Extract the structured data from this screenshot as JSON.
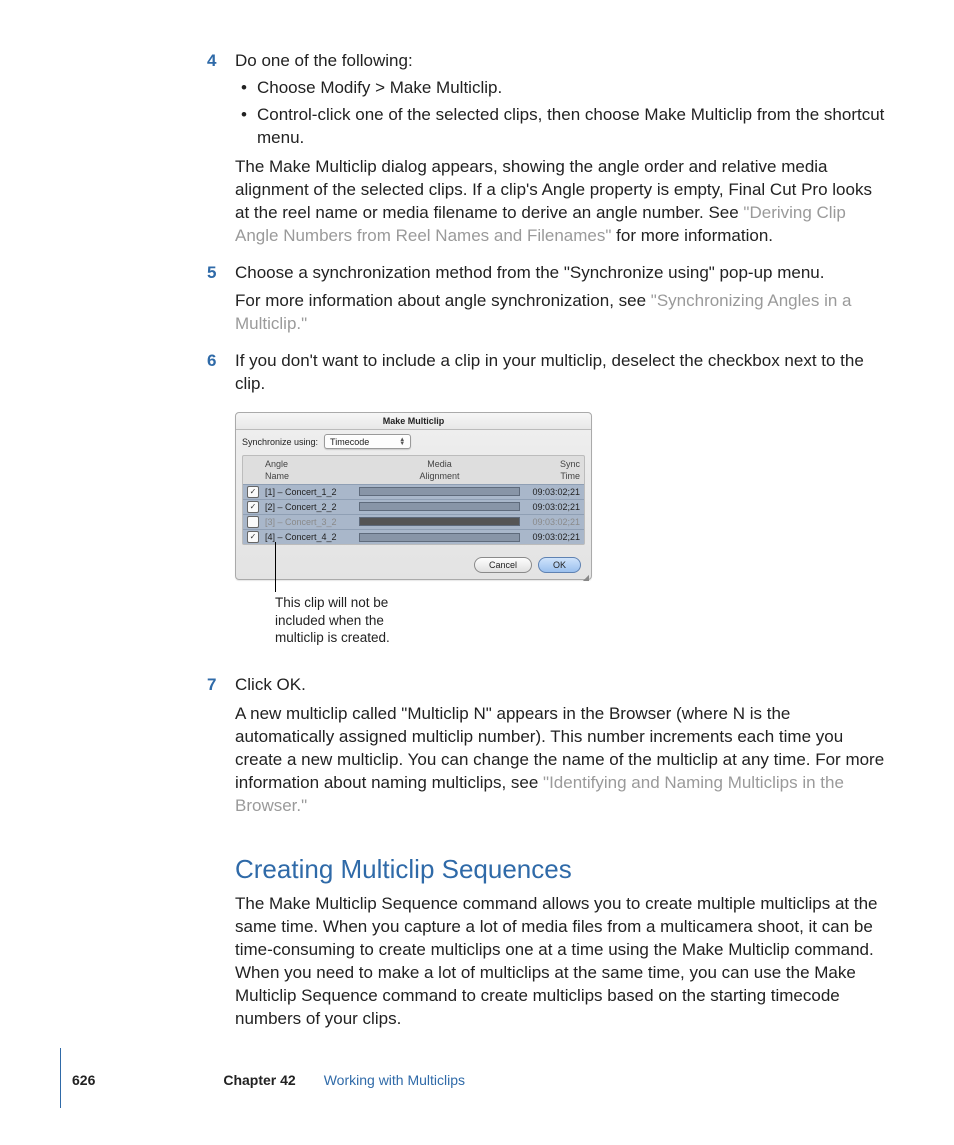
{
  "steps": {
    "s4": {
      "num": "4",
      "text": "Do one of the following:",
      "bullets": [
        "Choose Modify > Make Multiclip.",
        "Control-click one of the selected clips, then choose Make Multiclip from the shortcut menu."
      ],
      "para_pre": "The Make Multiclip dialog appears, showing the angle order and relative media alignment of the selected clips. If a clip's Angle property is empty, Final Cut Pro looks at the reel name or media filename to derive an angle number. See ",
      "para_link": "\"Deriving Clip Angle Numbers from Reel Names and Filenames\"",
      "para_post": " for more information."
    },
    "s5": {
      "num": "5",
      "text": "Choose a synchronization method from the \"Synchronize using\" pop-up menu.",
      "para_pre": "For more information about angle synchronization, see ",
      "para_link": "\"Synchronizing Angles in a Multiclip.\""
    },
    "s6": {
      "num": "6",
      "text": "If you don't want to include a clip in your multiclip, deselect the checkbox next to the clip."
    },
    "s7": {
      "num": "7",
      "text": "Click OK.",
      "para_pre": "A new multiclip called \"Multiclip N\" appears in the Browser (where N is the automatically assigned multiclip number). This number increments each time you create a new multiclip. You can change the name of the multiclip at any time. For more information about naming multiclips, see ",
      "para_link": "\"Identifying and Naming Multiclips in the Browser.\""
    }
  },
  "dialog": {
    "title": "Make Multiclip",
    "sync_label": "Synchronize using:",
    "sync_value": "Timecode",
    "headers": {
      "angle": "Angle\nName",
      "media": "Media\nAlignment",
      "sync": "Sync\nTime"
    },
    "rows": [
      {
        "checked": true,
        "angle": "[1] – Concert_1_2",
        "sync": "09:03:02;21",
        "disabled": false
      },
      {
        "checked": true,
        "angle": "[2] – Concert_2_2",
        "sync": "09:03:02;21",
        "disabled": false
      },
      {
        "checked": false,
        "angle": "[3] – Concert_3_2",
        "sync": "09:03:02;21",
        "disabled": true
      },
      {
        "checked": true,
        "angle": "[4] – Concert_4_2",
        "sync": "09:03:02;21",
        "disabled": false
      }
    ],
    "cancel": "Cancel",
    "ok": "OK"
  },
  "callout": "This clip will not be included when the multiclip is created.",
  "section": {
    "heading": "Creating Multiclip Sequences",
    "body": "The Make Multiclip Sequence command allows you to create multiple multiclips at the same time. When you capture a lot of media files from a multicamera shoot, it can be time-consuming to create multiclips one at a time using the Make Multiclip command. When you need to make a lot of multiclips at the same time, you can use the Make Multiclip Sequence command to create multiclips based on the starting timecode numbers of your clips."
  },
  "footer": {
    "page": "626",
    "chapter": "Chapter 42",
    "title": "Working with Multiclips"
  }
}
